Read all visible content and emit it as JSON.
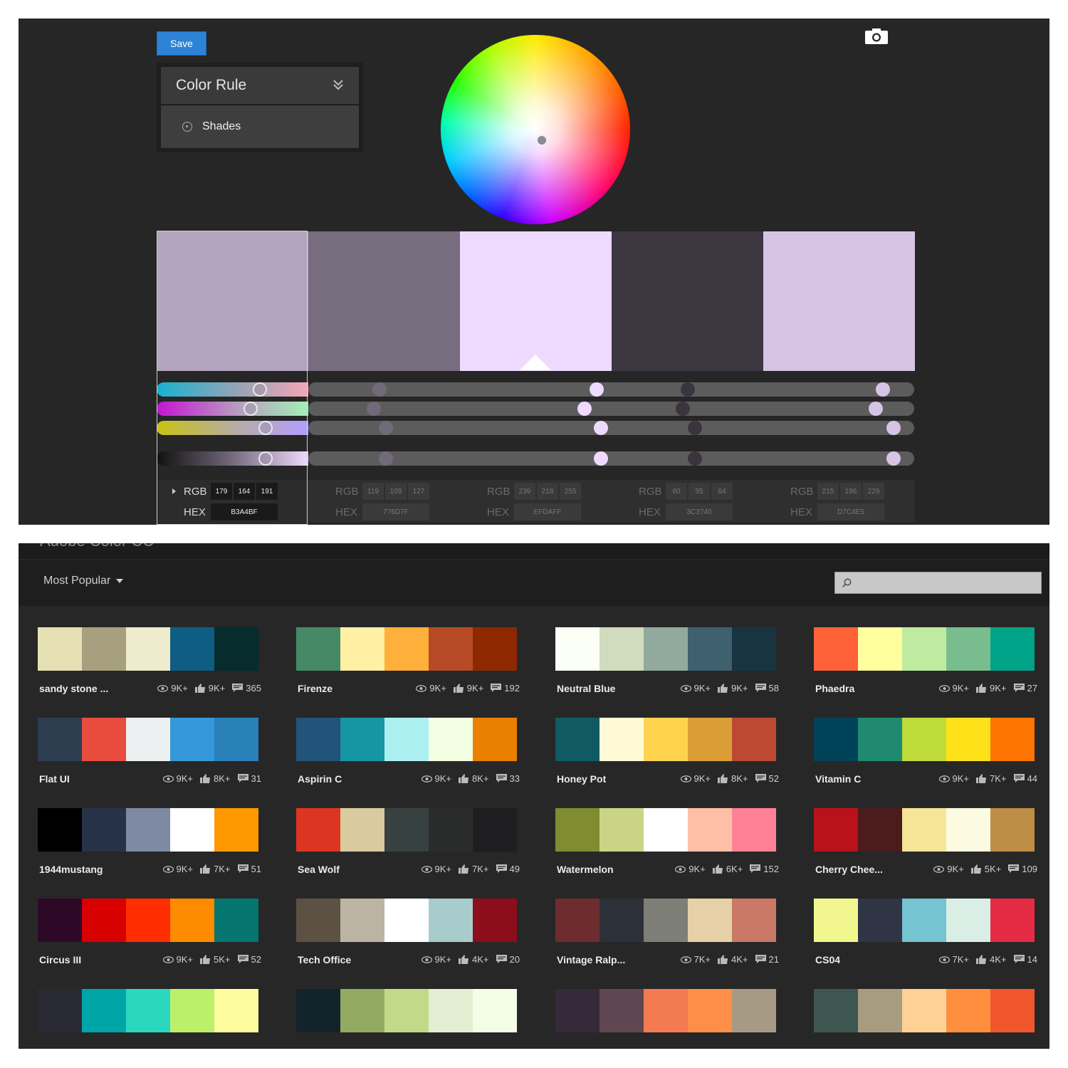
{
  "editor": {
    "save_label": "Save",
    "rule_title": "Color Rule",
    "rule_option": "Shades",
    "icons": [
      "chevron-double-down-icon",
      "radio-icon",
      "camera-icon"
    ],
    "swatches": [
      {
        "rgb": [
          "179",
          "164",
          "191"
        ],
        "hex": "B3A4BF",
        "color": "#b3a4bf",
        "active": true
      },
      {
        "rgb": [
          "119",
          "109",
          "127"
        ],
        "hex": "776D7F",
        "color": "#776d7f",
        "active": false
      },
      {
        "rgb": [
          "239",
          "218",
          "255"
        ],
        "hex": "EFDAFF",
        "color": "#efdaff",
        "active": false
      },
      {
        "rgb": [
          "60",
          "55",
          "64"
        ],
        "hex": "3C3740",
        "color": "#3c3740",
        "active": false
      },
      {
        "rgb": [
          "215",
          "196",
          "229"
        ],
        "hex": "D7C4E5",
        "color": "#d7c4e5",
        "active": false
      }
    ],
    "rgb_label": "RGB",
    "hex_label": "HEX"
  },
  "library": {
    "brand": "Adobe Color CC",
    "sort_label": "Most Popular",
    "search_placeholder": "",
    "themes": [
      {
        "name": "sandy stone ...",
        "views": "9K+",
        "likes": "9K+",
        "comments": "365",
        "colors": [
          "#e6e1b4",
          "#a6a07e",
          "#efecce",
          "#0e5d82",
          "#062c2d"
        ]
      },
      {
        "name": "Firenze",
        "views": "9K+",
        "likes": "9K+",
        "comments": "192",
        "colors": [
          "#468966",
          "#fff0a5",
          "#ffb03b",
          "#b64926",
          "#8e2800"
        ]
      },
      {
        "name": "Neutral Blue",
        "views": "9K+",
        "likes": "9K+",
        "comments": "58",
        "colors": [
          "#fcfff5",
          "#d1dbbd",
          "#91aa9d",
          "#3e606f",
          "#193441"
        ]
      },
      {
        "name": "Phaedra",
        "views": "9K+",
        "likes": "9K+",
        "comments": "27",
        "colors": [
          "#ff6138",
          "#ffff9d",
          "#beeb9f",
          "#79bd8f",
          "#00a388"
        ]
      },
      {
        "name": "Flat UI",
        "views": "9K+",
        "likes": "8K+",
        "comments": "31",
        "colors": [
          "#2c3e50",
          "#e74c3c",
          "#ecf0f1",
          "#3498db",
          "#2980b9"
        ]
      },
      {
        "name": "Aspirin C",
        "views": "9K+",
        "likes": "8K+",
        "comments": "33",
        "colors": [
          "#225378",
          "#1695a3",
          "#acf0f2",
          "#f3ffe2",
          "#eb7f00"
        ]
      },
      {
        "name": "Honey Pot",
        "views": "9K+",
        "likes": "8K+",
        "comments": "52",
        "colors": [
          "#105b63",
          "#fffad5",
          "#ffd34e",
          "#db9e36",
          "#bd4932"
        ]
      },
      {
        "name": "Vitamin C",
        "views": "9K+",
        "likes": "7K+",
        "comments": "44",
        "colors": [
          "#004358",
          "#1f8a70",
          "#bedb39",
          "#ffe11a",
          "#fd7400"
        ]
      },
      {
        "name": "1944mustang",
        "views": "9K+",
        "likes": "7K+",
        "comments": "51",
        "colors": [
          "#000000",
          "#263248",
          "#7e8aa2",
          "#ffffff",
          "#ff9800"
        ]
      },
      {
        "name": "Sea Wolf",
        "views": "9K+",
        "likes": "7K+",
        "comments": "49",
        "colors": [
          "#dc3522",
          "#d9cb9e",
          "#374140",
          "#2a2c2b",
          "#1e1e20"
        ]
      },
      {
        "name": "Watermelon",
        "views": "9K+",
        "likes": "6K+",
        "comments": "152",
        "colors": [
          "#7f8c2f",
          "#c9d585",
          "#ffffff",
          "#ffbfa6",
          "#ff8195"
        ]
      },
      {
        "name": "Cherry Chee...",
        "views": "9K+",
        "likes": "5K+",
        "comments": "109",
        "colors": [
          "#b9121b",
          "#4c1b1b",
          "#f6e497",
          "#fcfae1",
          "#bd8d46"
        ]
      },
      {
        "name": "Circus III",
        "views": "9K+",
        "likes": "5K+",
        "comments": "52",
        "colors": [
          "#2e0927",
          "#d90000",
          "#ff2d00",
          "#ff8c00",
          "#04756f"
        ]
      },
      {
        "name": "Tech Office",
        "views": "9K+",
        "likes": "4K+",
        "comments": "20",
        "colors": [
          "#5c5142",
          "#bcb4a2",
          "#ffffff",
          "#a8cbcb",
          "#8c0e1b"
        ]
      },
      {
        "name": "Vintage Ralp...",
        "views": "7K+",
        "likes": "4K+",
        "comments": "21",
        "colors": [
          "#6e2c2f",
          "#2c3038",
          "#7d7f77",
          "#e6d0a7",
          "#c97965"
        ]
      },
      {
        "name": "CS04",
        "views": "7K+",
        "likes": "4K+",
        "comments": "14",
        "colors": [
          "#f1f78e",
          "#2f3545",
          "#74c4d1",
          "#daeee6",
          "#e52b44"
        ]
      },
      {
        "name": "",
        "views": "",
        "likes": "",
        "comments": "",
        "colors": [
          "#2a2a34",
          "#00a5a8",
          "#2ad8c0",
          "#bbf06b",
          "#fdfda0"
        ]
      },
      {
        "name": "",
        "views": "",
        "likes": "",
        "comments": "",
        "colors": [
          "#13232c",
          "#93aa62",
          "#c2d98a",
          "#e4eed2",
          "#f4fde6"
        ]
      },
      {
        "name": "",
        "views": "",
        "likes": "",
        "comments": "",
        "colors": [
          "#362a3a",
          "#5f4651",
          "#f47a52",
          "#ff8f48",
          "#a79a84"
        ]
      },
      {
        "name": "",
        "views": "",
        "likes": "",
        "comments": "",
        "colors": [
          "#3d5650",
          "#a79d7e",
          "#fed194",
          "#ff8f3f",
          "#f1562d"
        ]
      }
    ]
  }
}
